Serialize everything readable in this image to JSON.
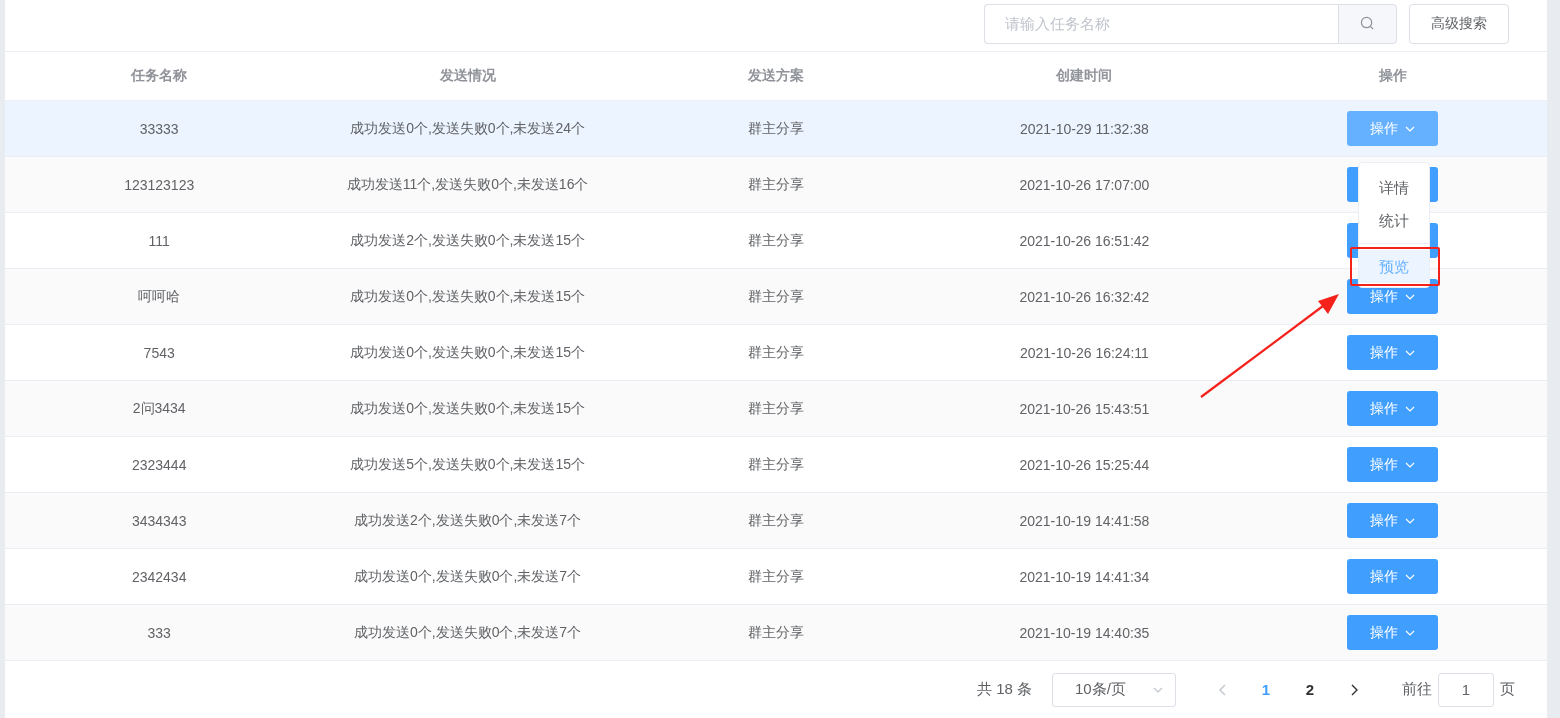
{
  "search": {
    "placeholder": "请输入任务名称"
  },
  "advanced_search_button": "高级搜索",
  "table": {
    "columns": [
      "任务名称",
      "发送情况",
      "发送方案",
      "创建时间",
      "操作"
    ],
    "rows": [
      {
        "name": "33333",
        "status": "成功发送0个,发送失败0个,未发送24个",
        "plan": "群主分享",
        "created": "2021-10-29 11:32:38",
        "action": "操作",
        "selected": true
      },
      {
        "name": "123123123",
        "status": "成功发送11个,发送失败0个,未发送16个",
        "plan": "群主分享",
        "created": "2021-10-26 17:07:00",
        "selected": false
      },
      {
        "name": "111",
        "status": "成功发送2个,发送失败0个,未发送15个",
        "plan": "群主分享",
        "created": "2021-10-26 16:51:42",
        "selected": false
      },
      {
        "name": "呵呵哈",
        "status": "成功发送0个,发送失败0个,未发送15个",
        "plan": "群主分享",
        "created": "2021-10-26 16:32:42",
        "action": "操作",
        "selected": false
      },
      {
        "name": "7543",
        "status": "成功发送0个,发送失败0个,未发送15个",
        "plan": "群主分享",
        "created": "2021-10-26 16:24:11",
        "action": "操作",
        "selected": false
      },
      {
        "name": "2问3434",
        "status": "成功发送0个,发送失败0个,未发送15个",
        "plan": "群主分享",
        "created": "2021-10-26 15:43:51",
        "action": "操作",
        "selected": false
      },
      {
        "name": "2323444",
        "status": "成功发送5个,发送失败0个,未发送15个",
        "plan": "群主分享",
        "created": "2021-10-26 15:25:44",
        "action": "操作",
        "selected": false
      },
      {
        "name": "3434343",
        "status": "成功发送2个,发送失败0个,未发送7个",
        "plan": "群主分享",
        "created": "2021-10-19 14:41:58",
        "action": "操作",
        "selected": false
      },
      {
        "name": "2342434",
        "status": "成功发送0个,发送失败0个,未发送7个",
        "plan": "群主分享",
        "created": "2021-10-19 14:41:34",
        "action": "操作",
        "selected": false
      },
      {
        "name": "333",
        "status": "成功发送0个,发送失败0个,未发送7个",
        "plan": "群主分享",
        "created": "2021-10-19 14:40:35",
        "action": "操作",
        "selected": false
      }
    ]
  },
  "action_menu": {
    "items": [
      {
        "label": "详情",
        "selected": false,
        "divided": false,
        "marked": false
      },
      {
        "label": "统计",
        "selected": false,
        "divided": false,
        "marked": false
      },
      {
        "label": "预览",
        "selected": true,
        "divided": true,
        "marked": true
      }
    ]
  },
  "pagination": {
    "total": "共 18 条",
    "page_size": "10条/页",
    "pages": [
      {
        "label": "1",
        "selected": true
      },
      {
        "label": "2",
        "selected": false
      }
    ],
    "prev_disabled": true,
    "goto_label": "前往",
    "goto_value": "1",
    "goto_suffix": "页"
  }
}
